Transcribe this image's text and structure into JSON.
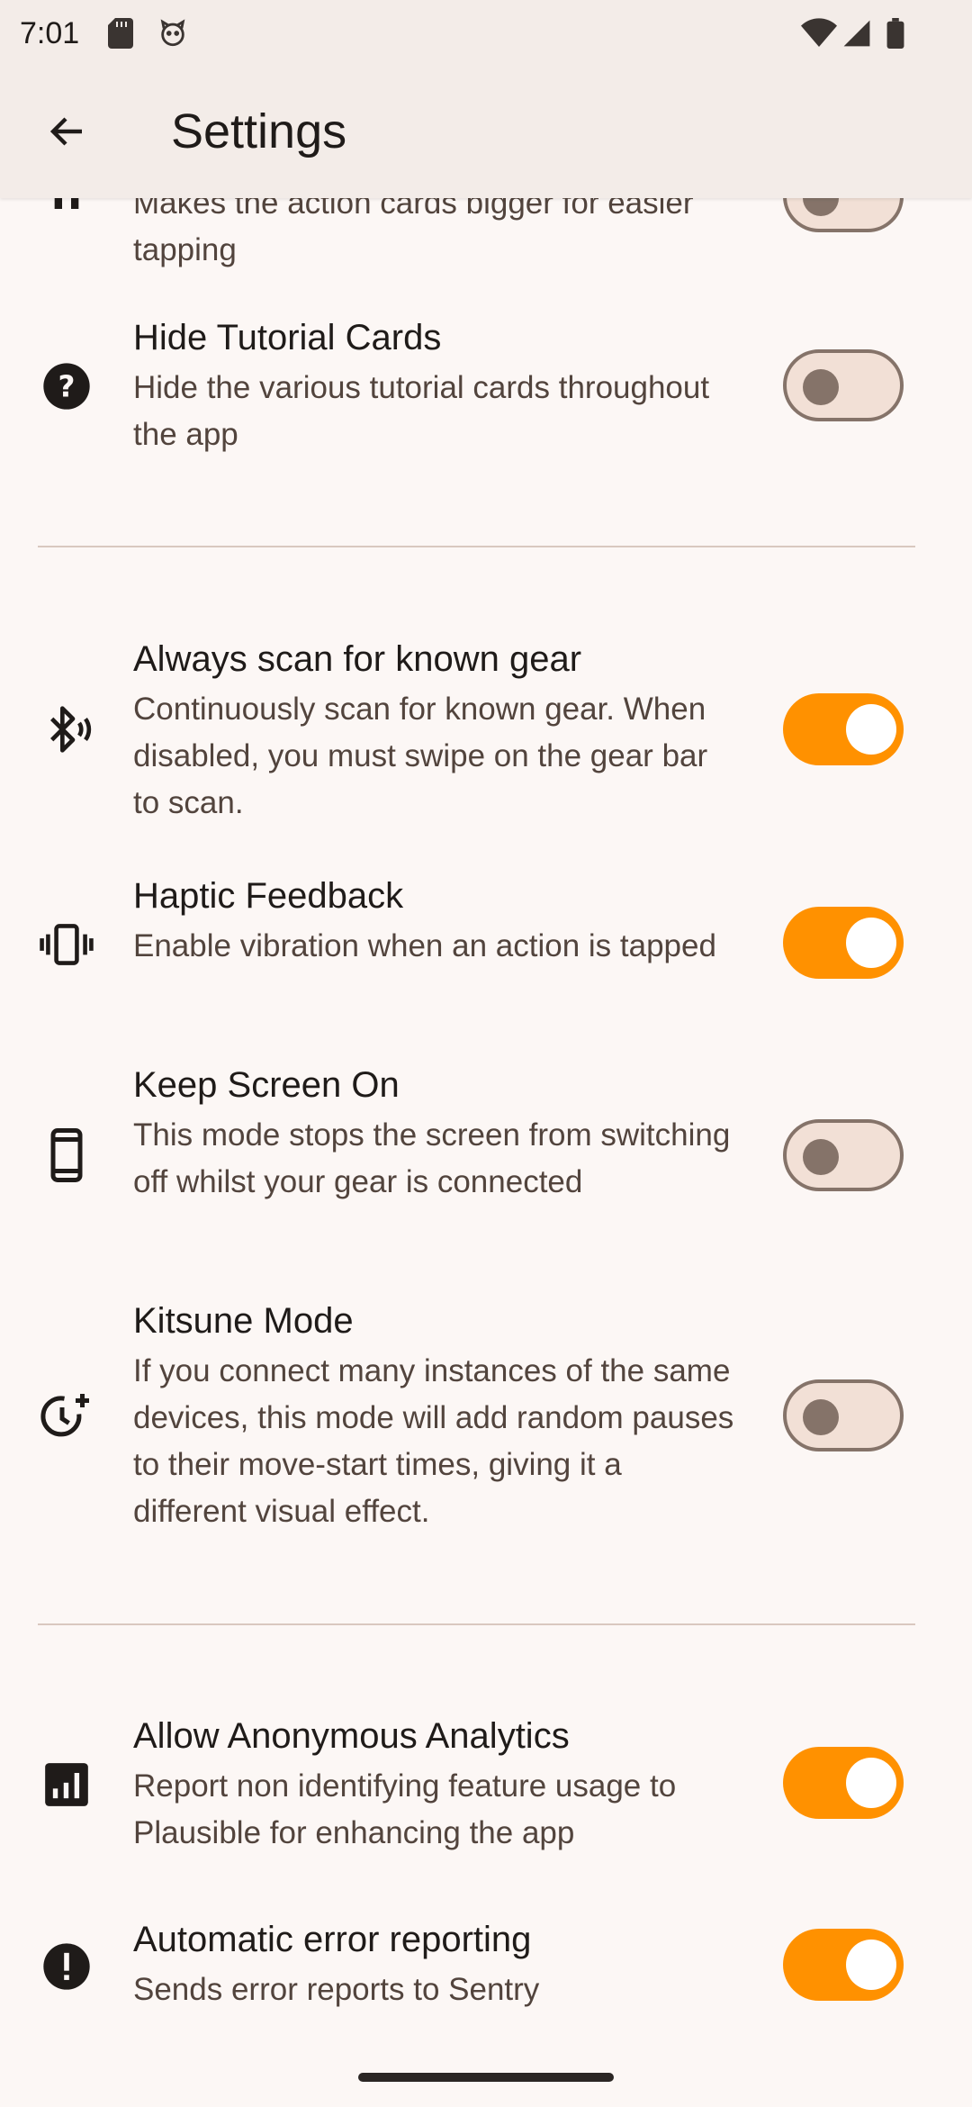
{
  "status": {
    "time": "7:01"
  },
  "appbar": {
    "title": "Settings"
  },
  "items": [
    {
      "title": "",
      "desc": "Makes the action cards bigger for easier tapping",
      "on": false,
      "icon": "large-cards-icon"
    },
    {
      "title": "Hide Tutorial Cards",
      "desc": "Hide the various tutorial cards throughout the app",
      "on": false,
      "icon": "help-circle-icon"
    },
    {
      "title": "Always scan for known gear",
      "desc": "Continuously scan for known gear. When disabled, you must swipe on the gear bar to scan.",
      "on": true,
      "icon": "bluetooth-searching-icon"
    },
    {
      "title": "Haptic Feedback",
      "desc": "Enable vibration when an action is tapped",
      "on": true,
      "icon": "vibration-icon"
    },
    {
      "title": "Keep Screen On",
      "desc": "This mode stops the screen from switching off whilst your gear is connected",
      "on": false,
      "icon": "phone-icon"
    },
    {
      "title": "Kitsune Mode",
      "desc": "If you connect many instances of the same devices, this mode will add random pauses to their move-start times, giving it a different visual effect.",
      "on": false,
      "icon": "timer-add-icon"
    },
    {
      "title": "Allow Anonymous Analytics",
      "desc": "Report non identifying feature usage to Plausible for enhancing the app",
      "on": true,
      "icon": "analytics-icon"
    },
    {
      "title": "Automatic error reporting",
      "desc": "Sends error reports to Sentry",
      "on": true,
      "icon": "error-icon"
    }
  ],
  "colors": {
    "accent": "#ff9100",
    "background": "#fcf7f5",
    "appbar": "#f3ece8"
  }
}
